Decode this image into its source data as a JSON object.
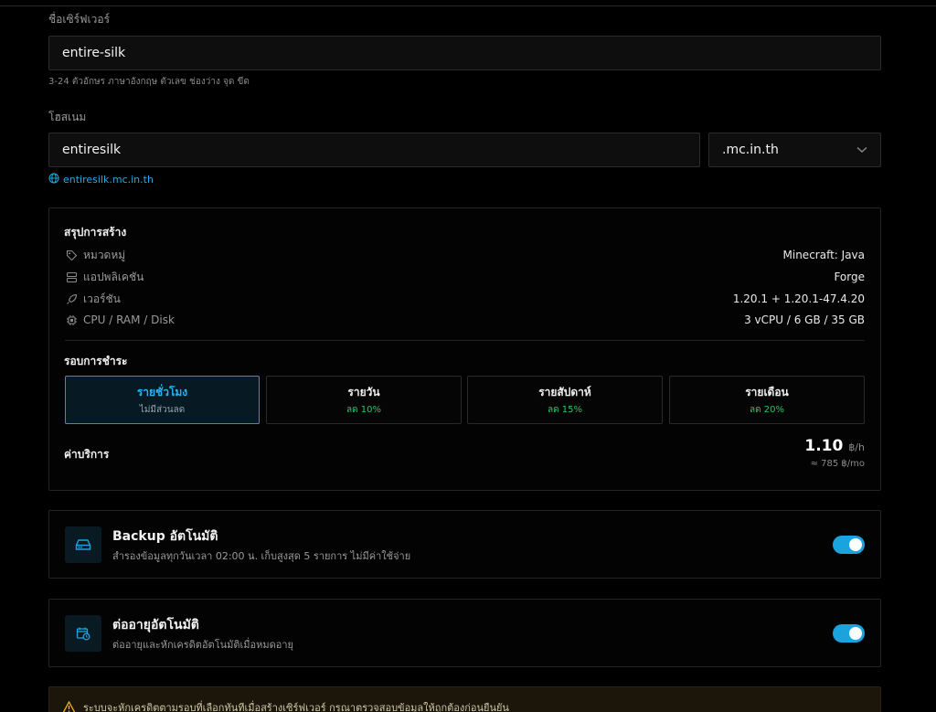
{
  "server_name": {
    "label": "ชื่อเซิร์ฟเวอร์",
    "value": "entire-silk",
    "hint": "3-24 ตัวอักษร ภาษาอังกฤษ ตัวเลข ช่องว่าง จุด ขีด"
  },
  "hostname": {
    "label": "โฮสเนม",
    "value": "entiresilk",
    "domain": ".mc.in.th",
    "full": "entiresilk.mc.in.th"
  },
  "summary": {
    "title": "สรุปการสร้าง",
    "rows": [
      {
        "key": "หมวดหมู่",
        "value": "Minecraft: Java",
        "icon": "tag-icon"
      },
      {
        "key": "แอปพลิเคชัน",
        "value": "Forge",
        "icon": "server-icon"
      },
      {
        "key": "เวอร์ชัน",
        "value": "1.20.1 + 1.20.1-47.4.20",
        "icon": "rocket-icon"
      },
      {
        "key": "CPU / RAM / Disk",
        "value": "3 vCPU / 6 GB / 35 GB",
        "icon": "cpu-icon"
      }
    ]
  },
  "billing": {
    "title": "รอบการชำระ",
    "options": [
      {
        "label": "รายชั่วโมง",
        "sub": "ไม่มีส่วนลด",
        "selected": true
      },
      {
        "label": "รายวัน",
        "sub": "ลด 10%",
        "selected": false
      },
      {
        "label": "รายสัปดาห์",
        "sub": "ลด 15%",
        "selected": false
      },
      {
        "label": "รายเดือน",
        "sub": "ลด 20%",
        "selected": false
      }
    ]
  },
  "fee": {
    "label": "ค่าบริการ",
    "price": "1.10",
    "unit": "฿/h",
    "per_month": "≈ 785 ฿/mo"
  },
  "backup": {
    "title": "Backup อัตโนมัติ",
    "desc": "สำรองข้อมูลทุกวันเวลา 02:00 น. เก็บสูงสุด 5 รายการ ไม่มีค่าใช้จ่าย",
    "enabled": true
  },
  "renew": {
    "title": "ต่ออายุอัตโนมัติ",
    "desc": "ต่ออายุและหักเครดิตอัตโนมัติเมื่อหมดอายุ",
    "enabled": true
  },
  "warning": {
    "text": "ระบบจะหักเครดิตตามรอบที่เลือกทันทีเมื่อสร้างเซิร์ฟเวอร์ กรุณาตรวจสอบข้อมูลให้ถูกต้องก่อนยืนยัน"
  },
  "colors": {
    "accent": "#1aa3df",
    "discount": "#2fc26a",
    "warning": "#f0b429"
  }
}
